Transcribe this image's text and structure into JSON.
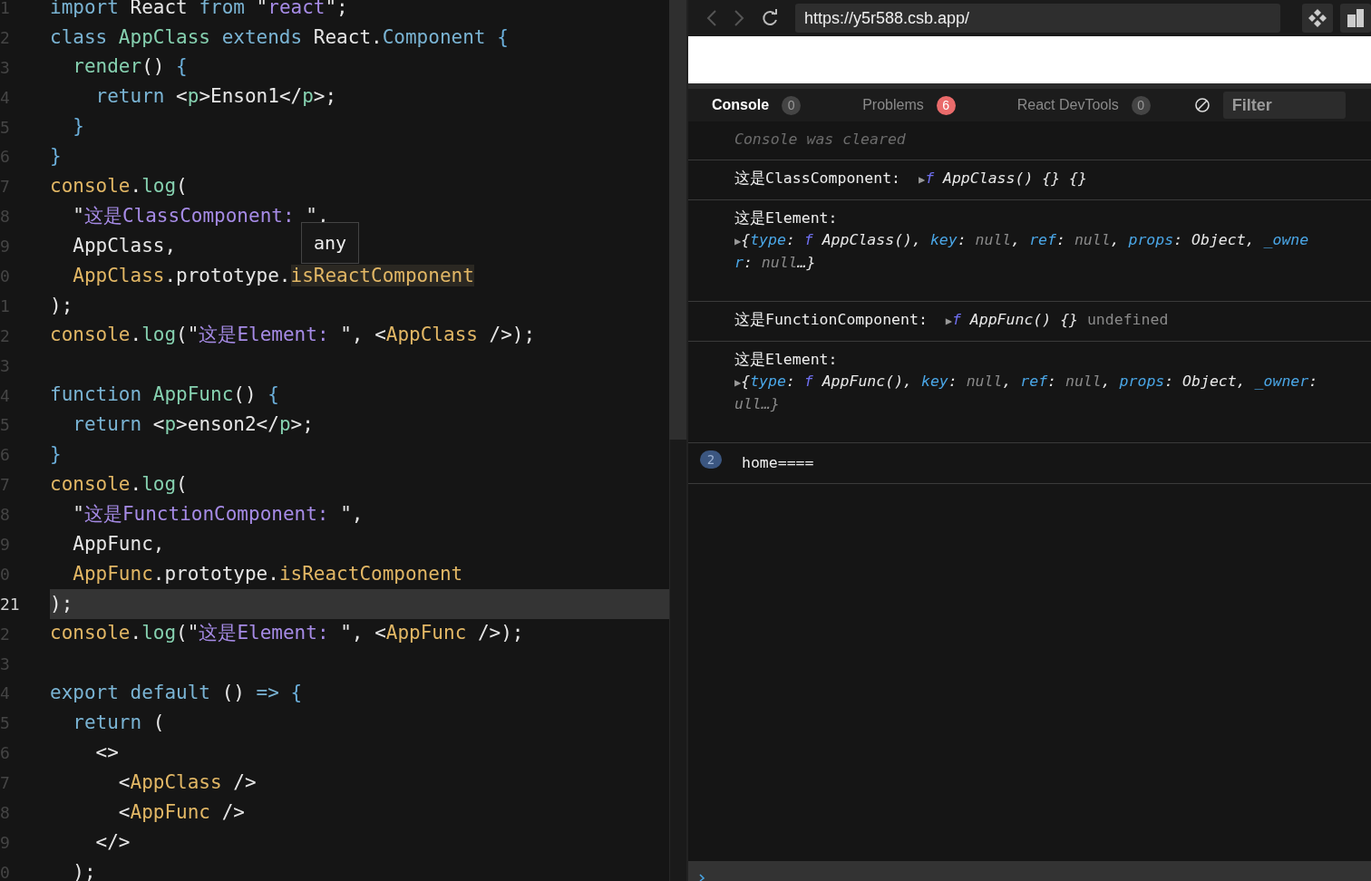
{
  "editor": {
    "lines": [
      {
        "number": "1",
        "current": false,
        "tokens": [
          {
            "kind": "kw",
            "text": "import"
          },
          {
            "kind": "plain",
            "text": " React "
          },
          {
            "kind": "kw",
            "text": "from"
          },
          {
            "kind": "plain",
            "text": " \""
          },
          {
            "kind": "str",
            "text": "react"
          },
          {
            "kind": "plain",
            "text": "\";"
          }
        ]
      },
      {
        "number": "2",
        "current": false,
        "tokens": [
          {
            "kind": "kw",
            "text": "class "
          },
          {
            "kind": "fn",
            "text": "AppClass "
          },
          {
            "kind": "kw",
            "text": "extends"
          },
          {
            "kind": "plain",
            "text": " React."
          },
          {
            "kind": "kw",
            "text": "Component "
          },
          {
            "kind": "brace",
            "text": "{"
          }
        ]
      },
      {
        "number": "3",
        "current": false,
        "tokens": [
          {
            "kind": "fn",
            "text": "  render"
          },
          {
            "kind": "plain",
            "text": "() "
          },
          {
            "kind": "brace",
            "text": "{"
          }
        ]
      },
      {
        "number": "4",
        "current": false,
        "tokens": [
          {
            "kind": "kw",
            "text": "    return"
          },
          {
            "kind": "plain",
            "text": " <"
          },
          {
            "kind": "tag",
            "text": "p"
          },
          {
            "kind": "plain",
            "text": ">Enson1</"
          },
          {
            "kind": "tag",
            "text": "p"
          },
          {
            "kind": "plain",
            "text": ">;"
          }
        ]
      },
      {
        "number": "5",
        "current": false,
        "tokens": [
          {
            "kind": "brace",
            "text": "  }"
          }
        ]
      },
      {
        "number": "6",
        "current": false,
        "tokens": [
          {
            "kind": "brace",
            "text": "}"
          }
        ]
      },
      {
        "number": "7",
        "current": false,
        "tokens": [
          {
            "kind": "obj",
            "text": "console"
          },
          {
            "kind": "plain",
            "text": "."
          },
          {
            "kind": "fn",
            "text": "log"
          },
          {
            "kind": "plain",
            "text": "("
          }
        ]
      },
      {
        "number": "8",
        "current": false,
        "tokens": [
          {
            "kind": "plain",
            "text": "  \""
          },
          {
            "kind": "str",
            "text": "这是ClassComponent: "
          },
          {
            "kind": "plain",
            "text": "\","
          }
        ]
      },
      {
        "number": "9",
        "current": false,
        "tokens": [
          {
            "kind": "plain",
            "text": "  AppClass,"
          }
        ]
      },
      {
        "number": "0",
        "current": false,
        "tokens": [
          {
            "kind": "obj",
            "text": "  AppClass"
          },
          {
            "kind": "plain",
            "text": ".prototype."
          },
          {
            "kind": "hl",
            "text": "isReactComponent"
          }
        ]
      },
      {
        "number": "1",
        "current": false,
        "tokens": [
          {
            "kind": "plain",
            "text": ");"
          }
        ]
      },
      {
        "number": "2",
        "current": false,
        "tokens": [
          {
            "kind": "obj",
            "text": "console"
          },
          {
            "kind": "plain",
            "text": "."
          },
          {
            "kind": "fn",
            "text": "log"
          },
          {
            "kind": "plain",
            "text": "(\""
          },
          {
            "kind": "str",
            "text": "这是Element: "
          },
          {
            "kind": "plain",
            "text": "\", <"
          },
          {
            "kind": "obj",
            "text": "AppClass"
          },
          {
            "kind": "plain",
            "text": " />);"
          }
        ]
      },
      {
        "number": "3",
        "current": false
      },
      {
        "number": "4",
        "current": false,
        "tokens": [
          {
            "kind": "kw",
            "text": "function "
          },
          {
            "kind": "fn",
            "text": "AppFunc"
          },
          {
            "kind": "plain",
            "text": "() "
          },
          {
            "kind": "brace",
            "text": "{"
          }
        ]
      },
      {
        "number": "5",
        "current": false,
        "tokens": [
          {
            "kind": "kw",
            "text": "  return"
          },
          {
            "kind": "plain",
            "text": " <"
          },
          {
            "kind": "tag",
            "text": "p"
          },
          {
            "kind": "plain",
            "text": ">enson2</"
          },
          {
            "kind": "tag",
            "text": "p"
          },
          {
            "kind": "plain",
            "text": ">;"
          }
        ]
      },
      {
        "number": "6",
        "current": false,
        "tokens": [
          {
            "kind": "brace",
            "text": "}"
          }
        ]
      },
      {
        "number": "7",
        "current": false,
        "tokens": [
          {
            "kind": "obj",
            "text": "console"
          },
          {
            "kind": "plain",
            "text": "."
          },
          {
            "kind": "fn",
            "text": "log"
          },
          {
            "kind": "plain",
            "text": "("
          }
        ]
      },
      {
        "number": "8",
        "current": false,
        "tokens": [
          {
            "kind": "plain",
            "text": "  \""
          },
          {
            "kind": "str",
            "text": "这是FunctionComponent: "
          },
          {
            "kind": "plain",
            "text": "\","
          }
        ]
      },
      {
        "number": "9",
        "current": false,
        "tokens": [
          {
            "kind": "plain",
            "text": "  AppFunc,"
          }
        ]
      },
      {
        "number": "0",
        "current": false,
        "tokens": [
          {
            "kind": "obj",
            "text": "  AppFunc"
          },
          {
            "kind": "plain",
            "text": ".prototype."
          },
          {
            "kind": "obj",
            "text": "isReactComponent"
          }
        ]
      },
      {
        "number": "21",
        "current": true,
        "tokens": [
          {
            "kind": "plain",
            "text": ");"
          }
        ]
      },
      {
        "number": "2",
        "current": false,
        "tokens": [
          {
            "kind": "obj",
            "text": "console"
          },
          {
            "kind": "plain",
            "text": "."
          },
          {
            "kind": "fn",
            "text": "log"
          },
          {
            "kind": "plain",
            "text": "(\""
          },
          {
            "kind": "str",
            "text": "这是Element: "
          },
          {
            "kind": "plain",
            "text": "\", <"
          },
          {
            "kind": "obj",
            "text": "AppFunc"
          },
          {
            "kind": "plain",
            "text": " />);"
          }
        ]
      },
      {
        "number": "3",
        "current": false
      },
      {
        "number": "4",
        "current": false,
        "tokens": [
          {
            "kind": "kw",
            "text": "export default"
          },
          {
            "kind": "plain",
            "text": " () "
          },
          {
            "kind": "kw",
            "text": "=> "
          },
          {
            "kind": "brace",
            "text": "{"
          }
        ]
      },
      {
        "number": "5",
        "current": false,
        "tokens": [
          {
            "kind": "kw",
            "text": "  return"
          },
          {
            "kind": "plain",
            "text": " ("
          }
        ]
      },
      {
        "number": "6",
        "current": false,
        "tokens": [
          {
            "kind": "plain",
            "text": "    <>"
          }
        ]
      },
      {
        "number": "7",
        "current": false,
        "tokens": [
          {
            "kind": "plain",
            "text": "      <"
          },
          {
            "kind": "obj",
            "text": "AppClass"
          },
          {
            "kind": "plain",
            "text": " />"
          }
        ]
      },
      {
        "number": "8",
        "current": false,
        "tokens": [
          {
            "kind": "plain",
            "text": "      <"
          },
          {
            "kind": "obj",
            "text": "AppFunc"
          },
          {
            "kind": "plain",
            "text": " />"
          }
        ]
      },
      {
        "number": "9",
        "current": false,
        "tokens": [
          {
            "kind": "plain",
            "text": "    </>"
          }
        ]
      },
      {
        "number": "0",
        "current": false,
        "tokens": [
          {
            "kind": "plain",
            "text": "  );"
          }
        ]
      }
    ],
    "tooltip": "any"
  },
  "browser": {
    "url": "https://y5r588.csb.app/"
  },
  "devtools": {
    "tabs": [
      {
        "label": "Console",
        "count": "0",
        "selected": true,
        "kind": "plain"
      },
      {
        "label": "Problems",
        "count": "6",
        "selected": false,
        "kind": "alert"
      },
      {
        "label": "React DevTools",
        "count": "0",
        "selected": false,
        "kind": "plain"
      }
    ],
    "filter": {
      "placeholder": "Filter"
    },
    "messages": [
      {
        "kind": "cleared",
        "lines": [
          [
            {
              "kind": "note",
              "text": "Console was cleared"
            }
          ]
        ]
      },
      {
        "kind": "log",
        "lines": [
          [
            {
              "kind": "label",
              "text": "这是ClassComponent:  "
            },
            {
              "kind": "arrow",
              "text": "▶"
            },
            {
              "kind": "f",
              "text": "f"
            },
            {
              "kind": "it",
              "text": " AppClass() {} {}"
            }
          ]
        ]
      },
      {
        "kind": "log",
        "lines": [
          [
            {
              "kind": "label",
              "text": "这是Element:"
            }
          ],
          [
            {
              "kind": "arrow",
              "text": "▶"
            },
            {
              "kind": "it",
              "text": "{"
            },
            {
              "kind": "key",
              "text": "type"
            },
            {
              "kind": "it",
              "text": ": "
            },
            {
              "kind": "f",
              "text": "f"
            },
            {
              "kind": "it",
              "text": " AppClass(), "
            },
            {
              "kind": "key",
              "text": "key"
            },
            {
              "kind": "it",
              "text": ": "
            },
            {
              "kind": "null",
              "text": "null"
            },
            {
              "kind": "it",
              "text": ", "
            },
            {
              "kind": "key",
              "text": "ref"
            },
            {
              "kind": "it",
              "text": ": "
            },
            {
              "kind": "null",
              "text": "null"
            },
            {
              "kind": "it",
              "text": ", "
            },
            {
              "kind": "key",
              "text": "props"
            },
            {
              "kind": "it",
              "text": ": Object, "
            },
            {
              "kind": "key",
              "text": "_owne"
            }
          ],
          [
            {
              "kind": "key",
              "text": "r"
            },
            {
              "kind": "it",
              "text": ": "
            },
            {
              "kind": "null",
              "text": "null"
            },
            {
              "kind": "it",
              "text": "…}"
            }
          ]
        ]
      },
      {
        "kind": "log",
        "lines": [
          [
            {
              "kind": "label",
              "text": "这是FunctionComponent:  "
            },
            {
              "kind": "arrow",
              "text": "▶"
            },
            {
              "kind": "f",
              "text": "f"
            },
            {
              "kind": "it",
              "text": " AppFunc() {} "
            },
            {
              "kind": "dim",
              "text": "undefined"
            }
          ]
        ]
      },
      {
        "kind": "log",
        "lines": [
          [
            {
              "kind": "label",
              "text": "这是Element:"
            }
          ],
          [
            {
              "kind": "arrow",
              "text": "▶"
            },
            {
              "kind": "it",
              "text": "{"
            },
            {
              "kind": "key",
              "text": "type"
            },
            {
              "kind": "it",
              "text": ": "
            },
            {
              "kind": "f",
              "text": "f"
            },
            {
              "kind": "it",
              "text": " AppFunc(), "
            },
            {
              "kind": "key",
              "text": "key"
            },
            {
              "kind": "it",
              "text": ": "
            },
            {
              "kind": "null",
              "text": "null"
            },
            {
              "kind": "it",
              "text": ", "
            },
            {
              "kind": "key",
              "text": "ref"
            },
            {
              "kind": "it",
              "text": ": "
            },
            {
              "kind": "null",
              "text": "null"
            },
            {
              "kind": "it",
              "text": ", "
            },
            {
              "kind": "key",
              "text": "props"
            },
            {
              "kind": "it",
              "text": ": Object, "
            },
            {
              "kind": "key",
              "text": "_owner"
            },
            {
              "kind": "it",
              "text": ":"
            }
          ],
          [
            {
              "kind": "null",
              "text": "ull…}"
            }
          ]
        ]
      },
      {
        "kind": "repeat",
        "count": "2",
        "lines": [
          [
            {
              "kind": "label",
              "text": "home===="
            }
          ]
        ]
      }
    ]
  }
}
